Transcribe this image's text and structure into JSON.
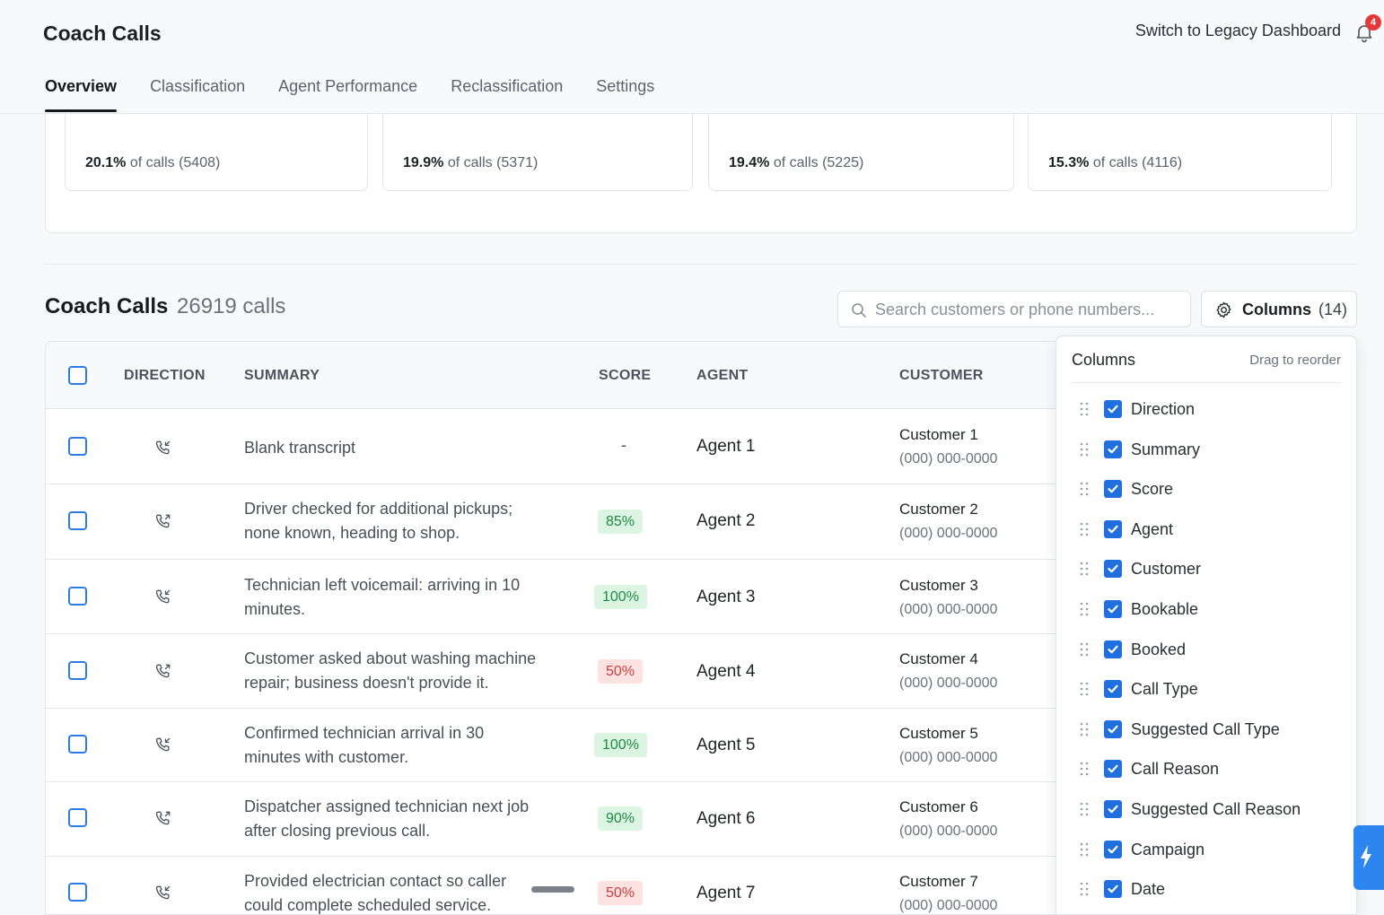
{
  "app": {
    "title": "Coach Calls",
    "legacy_link": "Switch to Legacy Dashboard",
    "notification_count": "4"
  },
  "tabs": [
    {
      "label": "Overview",
      "active": true
    },
    {
      "label": "Classification",
      "active": false
    },
    {
      "label": "Agent Performance",
      "active": false
    },
    {
      "label": "Reclassification",
      "active": false
    },
    {
      "label": "Settings",
      "active": false
    }
  ],
  "stats": [
    {
      "percent": "20.1%",
      "rest": "of calls (5408)"
    },
    {
      "percent": "19.9%",
      "rest": "of calls (5371)"
    },
    {
      "percent": "19.4%",
      "rest": "of calls (5225)"
    },
    {
      "percent": "15.3%",
      "rest": "of calls (4116)"
    }
  ],
  "section": {
    "title": "Coach Calls",
    "count": "26919 calls"
  },
  "search": {
    "placeholder": "Search customers or phone numbers...",
    "value": ""
  },
  "columns_button": {
    "label": "Columns",
    "count": "(14)"
  },
  "table": {
    "headers": {
      "direction": "DIRECTION",
      "summary": "SUMMARY",
      "score": "SCORE",
      "agent": "AGENT",
      "customer": "CUSTOMER"
    },
    "rows": [
      {
        "summary_1": "Blank transcript",
        "summary_2": "",
        "score": "-",
        "score_status": "none",
        "agent": "Agent 1",
        "customer": "Customer 1",
        "phone": "(000) 000-0000"
      },
      {
        "summary_1": "Driver checked for additional pickups;",
        "summary_2": "none known, heading to shop.",
        "score": "85%",
        "score_status": "good",
        "agent": "Agent 2",
        "customer": "Customer 2",
        "phone": "(000) 000-0000"
      },
      {
        "summary_1": "Technician left voicemail: arriving in 10",
        "summary_2": "minutes.",
        "score": "100%",
        "score_status": "good",
        "agent": "Agent 3",
        "customer": "Customer 3",
        "phone": "(000) 000-0000"
      },
      {
        "summary_1": "Customer asked about washing machine",
        "summary_2": "repair; business doesn't provide it.",
        "score": "50%",
        "score_status": "bad",
        "agent": "Agent 4",
        "customer": "Customer 4",
        "phone": "(000) 000-0000"
      },
      {
        "summary_1": "Confirmed technician arrival in 30",
        "summary_2": "minutes with customer.",
        "score": "100%",
        "score_status": "good",
        "agent": "Agent 5",
        "customer": "Customer 5",
        "phone": "(000) 000-0000"
      },
      {
        "summary_1": "Dispatcher assigned technician next job",
        "summary_2": "after closing previous call.",
        "score": "90%",
        "score_status": "good",
        "agent": "Agent 6",
        "customer": "Customer 6",
        "phone": "(000) 000-0000"
      },
      {
        "summary_1": "Provided electrician contact so caller",
        "summary_2": "could complete scheduled service.",
        "score": "50%",
        "score_status": "bad",
        "agent": "Agent 7",
        "customer": "Customer 7",
        "phone": "(000) 000-0000"
      }
    ]
  },
  "columns_panel": {
    "title": "Columns",
    "hint": "Drag to reorder",
    "items": [
      {
        "label": "Direction",
        "checked": true
      },
      {
        "label": "Summary",
        "checked": true
      },
      {
        "label": "Score",
        "checked": true
      },
      {
        "label": "Agent",
        "checked": true
      },
      {
        "label": "Customer",
        "checked": true
      },
      {
        "label": "Bookable",
        "checked": true
      },
      {
        "label": "Booked",
        "checked": true
      },
      {
        "label": "Call Type",
        "checked": true
      },
      {
        "label": "Suggested Call Type",
        "checked": true
      },
      {
        "label": "Call Reason",
        "checked": true
      },
      {
        "label": "Suggested Call Reason",
        "checked": true
      },
      {
        "label": "Campaign",
        "checked": true
      },
      {
        "label": "Date",
        "checked": true
      }
    ]
  },
  "colors": {
    "accent": "#1f6fde",
    "score_good_bg": "#dcf5e3",
    "score_good_text": "#1d8a43",
    "score_bad_bg": "#fde2e2",
    "score_bad_text": "#d13b3b",
    "badge": "#e5383b"
  },
  "icons": {
    "bell": "bell-icon",
    "search": "search-icon",
    "gear": "gear-icon",
    "call_direction": "phone-incoming-icon",
    "drag": "drag-handle-icon",
    "check": "check-icon"
  }
}
